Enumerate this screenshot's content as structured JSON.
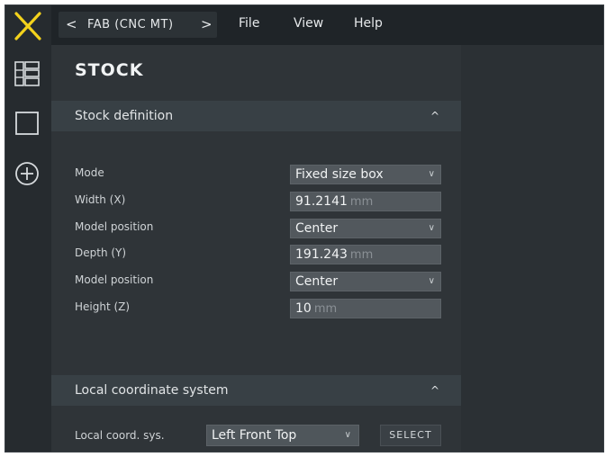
{
  "colors": {
    "brand_accent": "#f3d21c",
    "background": "#2a2f33"
  },
  "sidebar": {
    "icons": [
      "logo-x-icon",
      "grid-layout-icon",
      "square-icon",
      "add-circle-icon"
    ]
  },
  "topbar": {
    "crumb_prev": "<",
    "crumb_title": "FAB (CNC MT)",
    "crumb_next": ">",
    "menu": [
      "File",
      "View",
      "Help"
    ]
  },
  "panel": {
    "title": "STOCK",
    "stock_definition": {
      "header": "Stock definition",
      "caret": "^",
      "rows": [
        {
          "label": "Mode",
          "value": "Fixed size box",
          "unit": "",
          "type": "select"
        },
        {
          "label": "Width (X)",
          "value": "91.2141",
          "unit": "mm",
          "type": "input"
        },
        {
          "label": "Model position",
          "value": "Center",
          "unit": "",
          "type": "select"
        },
        {
          "label": "Depth (Y)",
          "value": "191.243",
          "unit": "mm",
          "type": "input"
        },
        {
          "label": "Model position",
          "value": "Center",
          "unit": "",
          "type": "select"
        },
        {
          "label": "Height (Z)",
          "value": "10",
          "unit": "mm",
          "type": "input"
        }
      ]
    },
    "local_coordinate_system": {
      "header": "Local coordinate system",
      "caret": "^",
      "label": "Local coord. sys.",
      "value": "Left Front Top",
      "button": "SELECT"
    }
  },
  "dropdown_glyph": "∨"
}
